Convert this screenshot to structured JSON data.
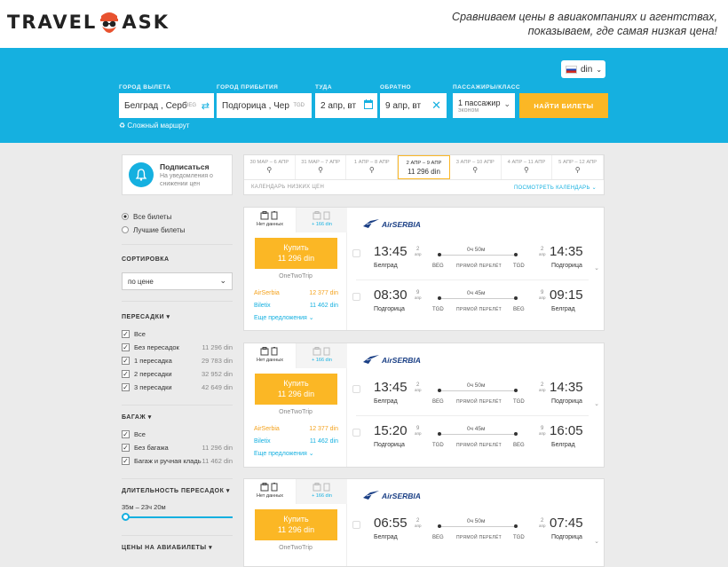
{
  "header": {
    "logo_left": "TRAVEL",
    "logo_right": "ASK",
    "slogan_line1": "Сравниваем цены в авиакомпаниях и агентствах,",
    "slogan_line2": "показываем, где самая низкая цена!"
  },
  "search": {
    "currency": "din",
    "from_label": "ГОРОД ВЫЛЕТА",
    "from_value": "Белград , Серб",
    "from_code": "BEG",
    "to_label": "ГОРОД ПРИБЫТИЯ",
    "to_value": "Подгорица , Чер",
    "to_code": "TGD",
    "depart_label": "ТУДА",
    "depart_value": "2 апр, вт",
    "return_label": "ОБРАТНО",
    "return_value": "9 апр, вт",
    "pax_label": "ПАССАЖИРЫ/КЛАСС",
    "pax_value": "1 пассажир",
    "pax_class": "эконом",
    "find_button": "НАЙТИ БИЛЕТЫ",
    "complex_route": "Сложный маршрут"
  },
  "subscribe": {
    "title": "Подписаться",
    "desc": "На уведомления о снижении цен"
  },
  "calendar": {
    "cells": [
      {
        "label": "30 МАР – 6 АПР",
        "price": ""
      },
      {
        "label": "31 МАР – 7 АПР",
        "price": ""
      },
      {
        "label": "1 АПР – 8 АПР",
        "price": ""
      },
      {
        "label": "2 АПР – 9 АПР",
        "price": "11 296 din"
      },
      {
        "label": "3 АПР – 10 АПР",
        "price": ""
      },
      {
        "label": "4 АПР – 11 АПР",
        "price": ""
      },
      {
        "label": "5 АПР – 12 АПР",
        "price": ""
      }
    ],
    "active_index": 3,
    "footer": "КАЛЕНДАРЬ НИЗКИХ ЦЕН",
    "more": "ПОСМОТРЕТЬ КАЛЕНДАРЬ"
  },
  "sidebar": {
    "all_tickets": "Все билеты",
    "best_tickets": "Лучшие билеты",
    "sort_title": "СОРТИРОВКА",
    "sort_value": "по цене",
    "stops_title": "ПЕРЕСАДКИ",
    "stops": [
      {
        "label": "Все",
        "price": ""
      },
      {
        "label": "Без пересадок",
        "price": "11 296 din"
      },
      {
        "label": "1 пересадка",
        "price": "29 783 din"
      },
      {
        "label": "2 пересадки",
        "price": "32 952 din"
      },
      {
        "label": "3 пересадки",
        "price": "42 649 din"
      }
    ],
    "baggage_title": "БАГАЖ",
    "baggage": [
      {
        "label": "Все",
        "price": ""
      },
      {
        "label": "Без багажа",
        "price": "11 296 din"
      },
      {
        "label": "Багаж и ручная кладь",
        "price": "11 462 din"
      }
    ],
    "duration_title": "ДЛИТЕЛЬНОСТЬ ПЕРЕСАДОК",
    "duration_range": "35м – 23ч 20м",
    "prices_title": "ЦЕНЫ НА АВИАБИЛЕТЫ"
  },
  "cards": [
    {
      "bag_tab1": "Нет данных",
      "bag_tab2": "+ 166 din",
      "buy_label": "Купить",
      "buy_price": "11 296 din",
      "agency": "OneTwoTrip",
      "offers": [
        {
          "name": "AirSerbia",
          "price": "12 377 din",
          "color": "#f4a21d"
        },
        {
          "name": "Biletix",
          "price": "11 462 din",
          "color": "#15b0e0"
        }
      ],
      "more": "Еще предложения",
      "airline": "AirSERBIA",
      "segments": [
        {
          "dep_time": "13:45",
          "dep_day": "2",
          "dep_mon": "апр",
          "dep_city": "Белград",
          "dep_code": "BEG",
          "duration": "0ч 50м",
          "direct": "ПРЯМОЙ ПЕРЕЛЁТ",
          "arr_code": "TGD",
          "arr_day": "2",
          "arr_mon": "апр",
          "arr_time": "14:35",
          "arr_city": "Подгорица"
        },
        {
          "dep_time": "08:30",
          "dep_day": "9",
          "dep_mon": "апр",
          "dep_city": "Подгорица",
          "dep_code": "TGD",
          "duration": "0ч 45м",
          "direct": "ПРЯМОЙ ПЕРЕЛЁТ",
          "arr_code": "BEG",
          "arr_day": "9",
          "arr_mon": "апр",
          "arr_time": "09:15",
          "arr_city": "Белград"
        }
      ]
    },
    {
      "bag_tab1": "Нет данных",
      "bag_tab2": "+ 166 din",
      "buy_label": "Купить",
      "buy_price": "11 296 din",
      "agency": "OneTwoTrip",
      "offers": [
        {
          "name": "AirSerbia",
          "price": "12 377 din",
          "color": "#f4a21d"
        },
        {
          "name": "Biletix",
          "price": "11 462 din",
          "color": "#15b0e0"
        }
      ],
      "more": "Еще предложения",
      "airline": "AirSERBIA",
      "segments": [
        {
          "dep_time": "13:45",
          "dep_day": "2",
          "dep_mon": "апр",
          "dep_city": "Белград",
          "dep_code": "BEG",
          "duration": "0ч 50м",
          "direct": "ПРЯМОЙ ПЕРЕЛЁТ",
          "arr_code": "TGD",
          "arr_day": "2",
          "arr_mon": "апр",
          "arr_time": "14:35",
          "arr_city": "Подгорица"
        },
        {
          "dep_time": "15:20",
          "dep_day": "9",
          "dep_mon": "апр",
          "dep_city": "Подгорица",
          "dep_code": "TGD",
          "duration": "0ч 45м",
          "direct": "ПРЯМОЙ ПЕРЕЛЁТ",
          "arr_code": "BEG",
          "arr_day": "9",
          "arr_mon": "апр",
          "arr_time": "16:05",
          "arr_city": "Белград"
        }
      ]
    },
    {
      "bag_tab1": "Нет данных",
      "bag_tab2": "+ 166 din",
      "buy_label": "Купить",
      "buy_price": "11 296 din",
      "agency": "OneTwoTrip",
      "offers": [],
      "more": "",
      "airline": "AirSERBIA",
      "segments": [
        {
          "dep_time": "06:55",
          "dep_day": "2",
          "dep_mon": "апр",
          "dep_city": "Белград",
          "dep_code": "BEG",
          "duration": "0ч 50м",
          "direct": "ПРЯМОЙ ПЕРЕЛЁТ",
          "arr_code": "TGD",
          "arr_day": "2",
          "arr_mon": "апр",
          "arr_time": "07:45",
          "arr_city": "Подгорица"
        }
      ]
    }
  ]
}
